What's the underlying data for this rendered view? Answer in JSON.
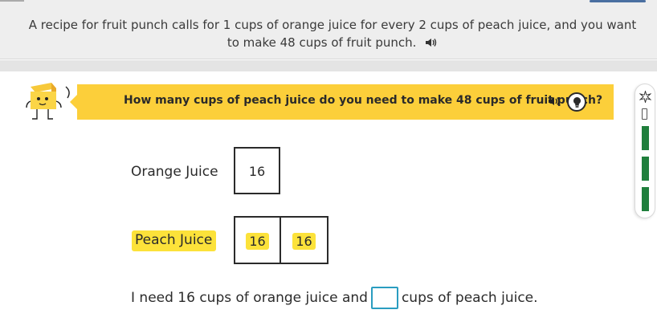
{
  "problem": {
    "line1": "A recipe for fruit punch calls for 1 cups of orange juice for every 2 cups of peach juice, and you want",
    "line2": "to make 48 cups of fruit punch."
  },
  "banner": {
    "question": "How many cups of peach juice do you need to make 48 cups of fruit punch?"
  },
  "tape": {
    "orange_label": "Orange Juice",
    "peach_label": "Peach Juice",
    "orange_values": [
      "16"
    ],
    "peach_values": [
      "16",
      "16"
    ]
  },
  "answer": {
    "before": "I need 16 cups of orange juice and",
    "after": "cups of peach juice.",
    "value": ""
  },
  "colors": {
    "banner": "#fccf3a",
    "highlight": "#fce23a",
    "input_border": "#2a9dc0",
    "progress": "#1f7f3c"
  },
  "icons": [
    "speaker-icon",
    "lightbulb-icon",
    "sparkle-icon",
    "mascot-icon"
  ]
}
